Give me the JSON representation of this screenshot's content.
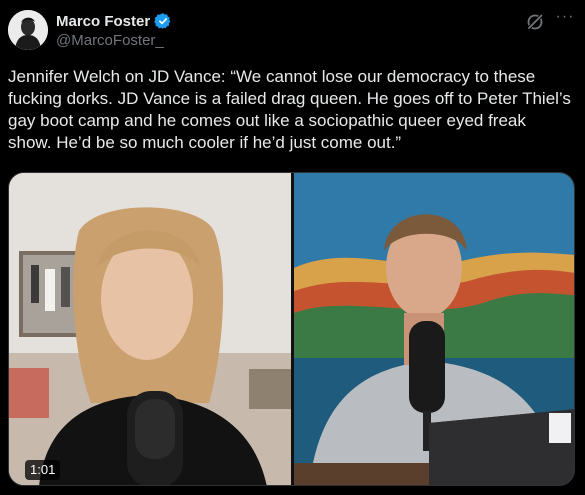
{
  "post": {
    "author_name": "Marco Foster",
    "author_handle": "@MarcoFoster_",
    "text": "Jennifer Welch on JD Vance: “We cannot lose our democracy to these fucking dorks. JD Vance is a failed drag queen. He goes off to Peter Thiel’s gay boot camp and he comes out like a sociopathic queer eyed freak show. He’d be so much cooler if he’d just come out.”",
    "more_label": "···"
  },
  "video": {
    "duration": "1:01"
  },
  "icons": {
    "verified": "verified-badge-icon",
    "grok": "grok-icon",
    "more": "more-icon"
  },
  "colors": {
    "background": "#000000",
    "text": "#e7e9ea",
    "secondary_text": "#71767b",
    "verified_blue": "#1d9bf0"
  }
}
